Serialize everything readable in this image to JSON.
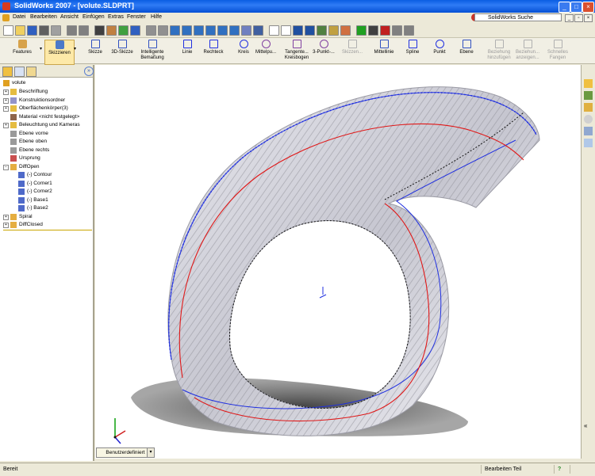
{
  "window": {
    "title": "SolidWorks 2007 - [volute.SLDPRT]"
  },
  "menu": {
    "items": [
      "Datei",
      "Bearbeiten",
      "Ansicht",
      "Einfügen",
      "Extras",
      "Fenster",
      "Hilfe"
    ],
    "search_label": "SolidWorks Suche"
  },
  "commandmanager": {
    "tabs": [
      {
        "label": "Features"
      },
      {
        "label": "Skizzieren"
      }
    ],
    "tools": [
      {
        "label": "Skizze",
        "icon": "sketch-icon",
        "enabled": true
      },
      {
        "label": "3D-Skizze",
        "icon": "3d-sketch-icon",
        "enabled": true
      },
      {
        "label": "Intelligente Bemaßung",
        "icon": "smart-dimension-icon",
        "enabled": true
      },
      {
        "label": "Linie",
        "icon": "line-icon",
        "enabled": true
      },
      {
        "label": "Rechteck",
        "icon": "rectangle-icon",
        "enabled": true
      },
      {
        "label": "Kreis",
        "icon": "circle-icon",
        "enabled": true
      },
      {
        "label": "Mittelpu...",
        "icon": "centerpoint-arc-icon",
        "enabled": true
      },
      {
        "label": "Tangente... Kreisbogen",
        "icon": "tangent-arc-icon",
        "enabled": true
      },
      {
        "label": "3-Punkt-...",
        "icon": "3point-arc-icon",
        "enabled": true
      },
      {
        "label": "Skizzen...",
        "icon": "sketch-fillet-icon",
        "enabled": false
      },
      {
        "label": "Mittellinie",
        "icon": "centerline-icon",
        "enabled": true
      },
      {
        "label": "Spline",
        "icon": "spline-icon",
        "enabled": true
      },
      {
        "label": "Punkt",
        "icon": "point-icon",
        "enabled": true
      },
      {
        "label": "Ebene",
        "icon": "plane-icon",
        "enabled": true
      },
      {
        "label": "Beziehung hinzufügen",
        "icon": "add-relation-icon",
        "enabled": false
      },
      {
        "label": "Beziehun... anzeigen...",
        "icon": "display-relations-icon",
        "enabled": false
      },
      {
        "label": "Schnelles Fangen",
        "icon": "quick-snaps-icon",
        "enabled": false
      }
    ]
  },
  "tree": {
    "root": "volute",
    "items": [
      {
        "label": "Beschriftung",
        "expand": true,
        "indent": 1,
        "icon": "annotations-icon",
        "color": "#e0b020"
      },
      {
        "label": "Konstruktionsordner",
        "expand": true,
        "indent": 1,
        "icon": "design-binder-icon",
        "color": "#8080c0"
      },
      {
        "label": "Oberflächenkörper(3)",
        "expand": true,
        "indent": 1,
        "icon": "surface-bodies-icon",
        "color": "#e0b020"
      },
      {
        "label": "Material <nicht festgelegt>",
        "expand": false,
        "indent": 1,
        "icon": "material-icon",
        "color": "#7a4a2a"
      },
      {
        "label": "Beleuchtung und Kameras",
        "expand": true,
        "indent": 1,
        "icon": "lights-icon",
        "color": "#e0b020"
      },
      {
        "label": "Ebene vorne",
        "expand": false,
        "indent": 1,
        "icon": "plane-icon",
        "color": "#888888"
      },
      {
        "label": "Ebene oben",
        "expand": false,
        "indent": 1,
        "icon": "plane-icon",
        "color": "#888888"
      },
      {
        "label": "Ebene rechts",
        "expand": false,
        "indent": 1,
        "icon": "plane-icon",
        "color": "#888888"
      },
      {
        "label": "Ursprung",
        "expand": false,
        "indent": 1,
        "icon": "origin-icon",
        "color": "#c03030"
      },
      {
        "label": "DiffOpen",
        "expand": "open",
        "indent": 1,
        "icon": "folder-icon",
        "color": "#e0a020"
      },
      {
        "label": "(-) Contour",
        "expand": false,
        "indent": 2,
        "icon": "sketch-icon",
        "color": "#3050c0"
      },
      {
        "label": "(-) Corner1",
        "expand": false,
        "indent": 2,
        "icon": "sketch-icon",
        "color": "#3050c0"
      },
      {
        "label": "(-) Corner2",
        "expand": false,
        "indent": 2,
        "icon": "sketch-icon",
        "color": "#3050c0"
      },
      {
        "label": "(-) Base1",
        "expand": false,
        "indent": 2,
        "icon": "sketch-icon",
        "color": "#3050c0"
      },
      {
        "label": "(-) Base2",
        "expand": false,
        "indent": 2,
        "icon": "sketch-icon",
        "color": "#3050c0"
      },
      {
        "label": "Spiral",
        "expand": true,
        "indent": 1,
        "icon": "folder-icon",
        "color": "#e0a020"
      },
      {
        "label": "DiffClosed",
        "expand": true,
        "indent": 1,
        "icon": "folder-icon",
        "color": "#e0a020"
      }
    ]
  },
  "view": {
    "orientation": "Benutzerdefiniert"
  },
  "status": {
    "left": "Bereit",
    "mode": "Bearbeiten Teil",
    "help": "?"
  },
  "colors": {
    "curve_blue": "#1f2fe0",
    "curve_red": "#e01818",
    "curve_black": "#111111",
    "surface": "#c9c9d2"
  }
}
